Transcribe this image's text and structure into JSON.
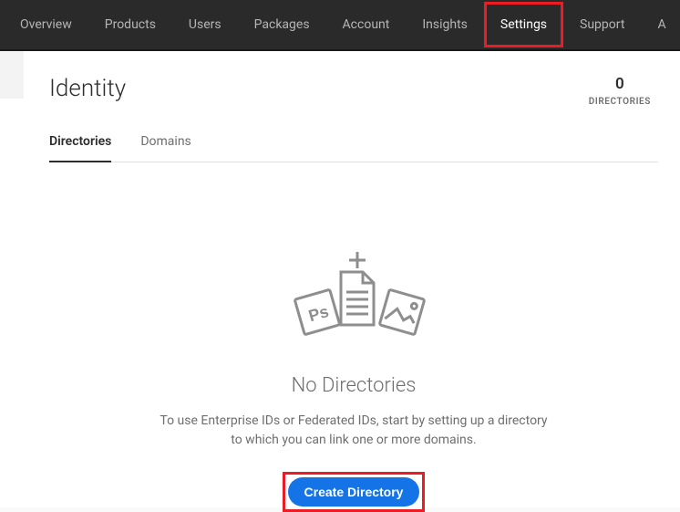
{
  "nav": {
    "items": [
      {
        "label": "Overview"
      },
      {
        "label": "Products"
      },
      {
        "label": "Users"
      },
      {
        "label": "Packages"
      },
      {
        "label": "Account"
      },
      {
        "label": "Insights"
      },
      {
        "label": "Settings",
        "active": true
      },
      {
        "label": "Support"
      },
      {
        "label": "A"
      }
    ]
  },
  "page": {
    "title": "Identity",
    "count_value": "0",
    "count_label": "DIRECTORIES"
  },
  "sub_tabs": {
    "items": [
      {
        "label": "Directories",
        "active": true
      },
      {
        "label": "Domains"
      }
    ]
  },
  "empty_state": {
    "title": "No Directories",
    "description": "To use Enterprise IDs or Federated IDs, start by setting up a directory to which you can link one or more domains.",
    "button_label": "Create Directory"
  }
}
